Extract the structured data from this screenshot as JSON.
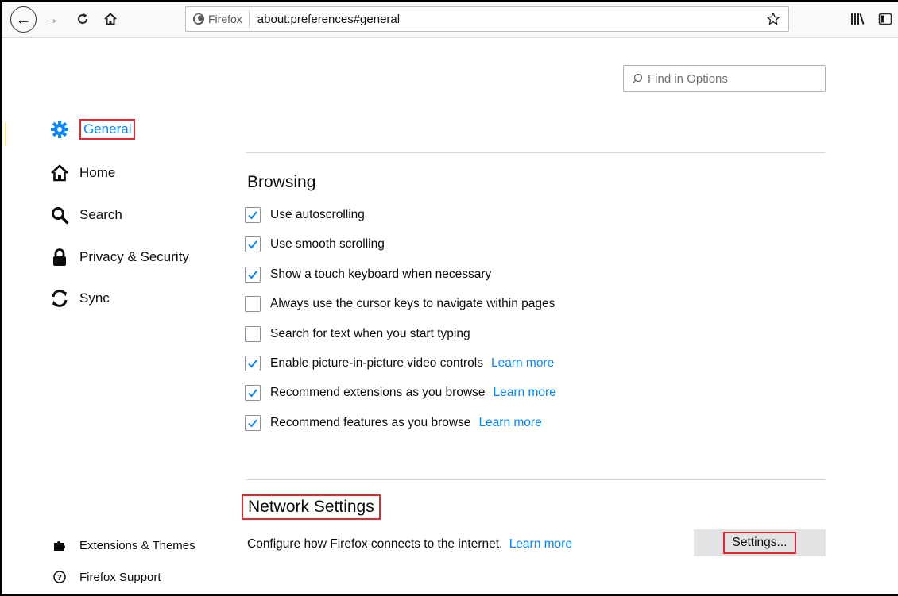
{
  "toolbar": {
    "identity_label": "Firefox",
    "url": "about:preferences#general"
  },
  "search": {
    "placeholder": "Find in Options"
  },
  "categories": [
    {
      "label": "General",
      "icon": "gear-icon",
      "selected": true
    },
    {
      "label": "Home",
      "icon": "home-icon"
    },
    {
      "label": "Search",
      "icon": "search-icon"
    },
    {
      "label": "Privacy & Security",
      "icon": "lock-icon"
    },
    {
      "label": "Sync",
      "icon": "sync-icon"
    }
  ],
  "footer_links": [
    {
      "label": "Extensions & Themes",
      "icon": "puzzle-icon"
    },
    {
      "label": "Firefox Support",
      "icon": "help-icon"
    }
  ],
  "browsing": {
    "title": "Browsing",
    "options": [
      {
        "label": "Use autoscrolling",
        "checked": true
      },
      {
        "label": "Use smooth scrolling",
        "checked": true
      },
      {
        "label": "Show a touch keyboard when necessary",
        "checked": true
      },
      {
        "label": "Always use the cursor keys to navigate within pages",
        "checked": false
      },
      {
        "label": "Search for text when you start typing",
        "checked": false
      },
      {
        "label": "Enable picture-in-picture video controls",
        "checked": true,
        "learn_more": "Learn more"
      },
      {
        "label": "Recommend extensions as you browse",
        "checked": true,
        "learn_more": "Learn more"
      },
      {
        "label": "Recommend features as you browse",
        "checked": true,
        "learn_more": "Learn more"
      }
    ]
  },
  "network": {
    "title": "Network Settings",
    "description": "Configure how Firefox connects to the internet.",
    "learn_more": "Learn more",
    "button_label": "Settings..."
  },
  "colors": {
    "accent": "#0a84ff",
    "highlight_border": "#e8262d"
  }
}
